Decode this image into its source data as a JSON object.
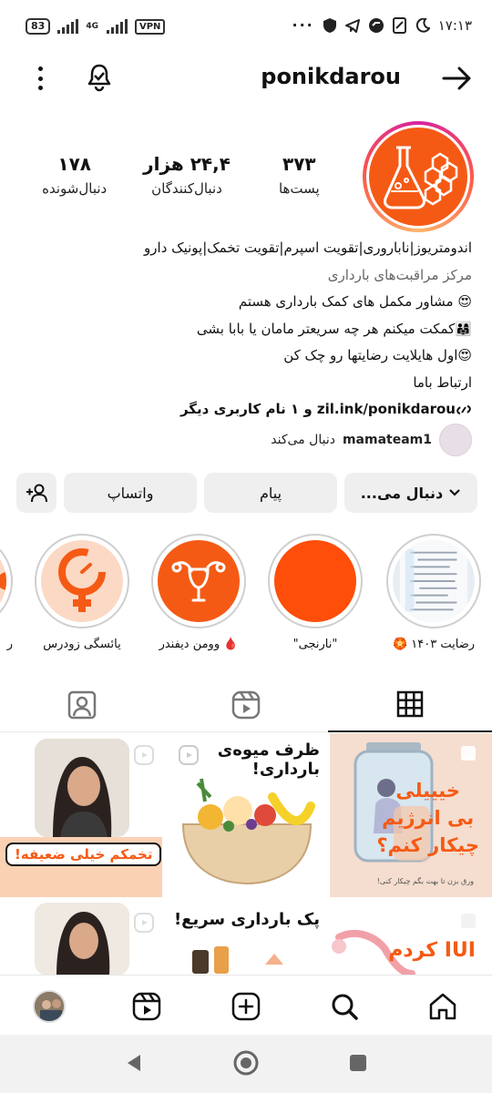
{
  "status_bar": {
    "battery": "83",
    "network": "4G",
    "vpn": "VPN",
    "time": "۱۷:۱۳"
  },
  "header": {
    "username": "ponikdarou"
  },
  "stats": [
    {
      "num": "۳۷۳",
      "label": "پست‌ها"
    },
    {
      "num": "۲۴,۴ هزار",
      "label": "دنبال‌کنندگان"
    },
    {
      "num": "۱۷۸",
      "label": "دنبال‌شونده"
    }
  ],
  "bio": {
    "name": "اندومتریوز|ناباروری|تقویت اسپرم|تقویت تخمک|پونیک دارو",
    "category": "مرکز مراقبت‌های بارداری",
    "line1": "😍 مشاور مکمل های کمک بارداری هستم",
    "line2": "👨‍👩‍👧کمکت میکنم هر چه سریعتر مامان یا بابا بشی",
    "line3": "😍اول هایلایت رضایتها رو چک کن",
    "line4": "ارتباط باما",
    "link": "zil.ink/ponikdarou",
    "link_more": "و ۱ نام کاربری دیگر"
  },
  "followed_by": {
    "user": "mamateam1",
    "text": "دنبال می‌کند"
  },
  "buttons": {
    "follow": "دنبال می...",
    "message": "پیام",
    "whatsapp": "واتساپ"
  },
  "highlights": [
    {
      "label": "رضایت ۱۴۰۳ 🏵️"
    },
    {
      "label": "\"نارنجی\""
    },
    {
      "label": "🩸 وومن دیفندر"
    },
    {
      "label": "یائسگی زودرس"
    },
    {
      "label": "ر"
    }
  ],
  "grid": {
    "tile1_line1": "خیییلی",
    "tile1_line2": "بی انرژیم",
    "tile1_line3": "چیکار کنم؟",
    "tile1_caption": "ورق بزن تا بهت بگم چیکار کنی!",
    "tile2_title": "ظرف میوه‌ی بارداری!",
    "tile3_caption": "تخمکم خیلی ضعیفه!",
    "tile4_text": "IUI کردم",
    "tile5_title": "پک بارداری سریع!"
  },
  "colors": {
    "brand_orange": "#f55a15",
    "button_bg": "#efefef",
    "peach": "#f8c4a6"
  }
}
